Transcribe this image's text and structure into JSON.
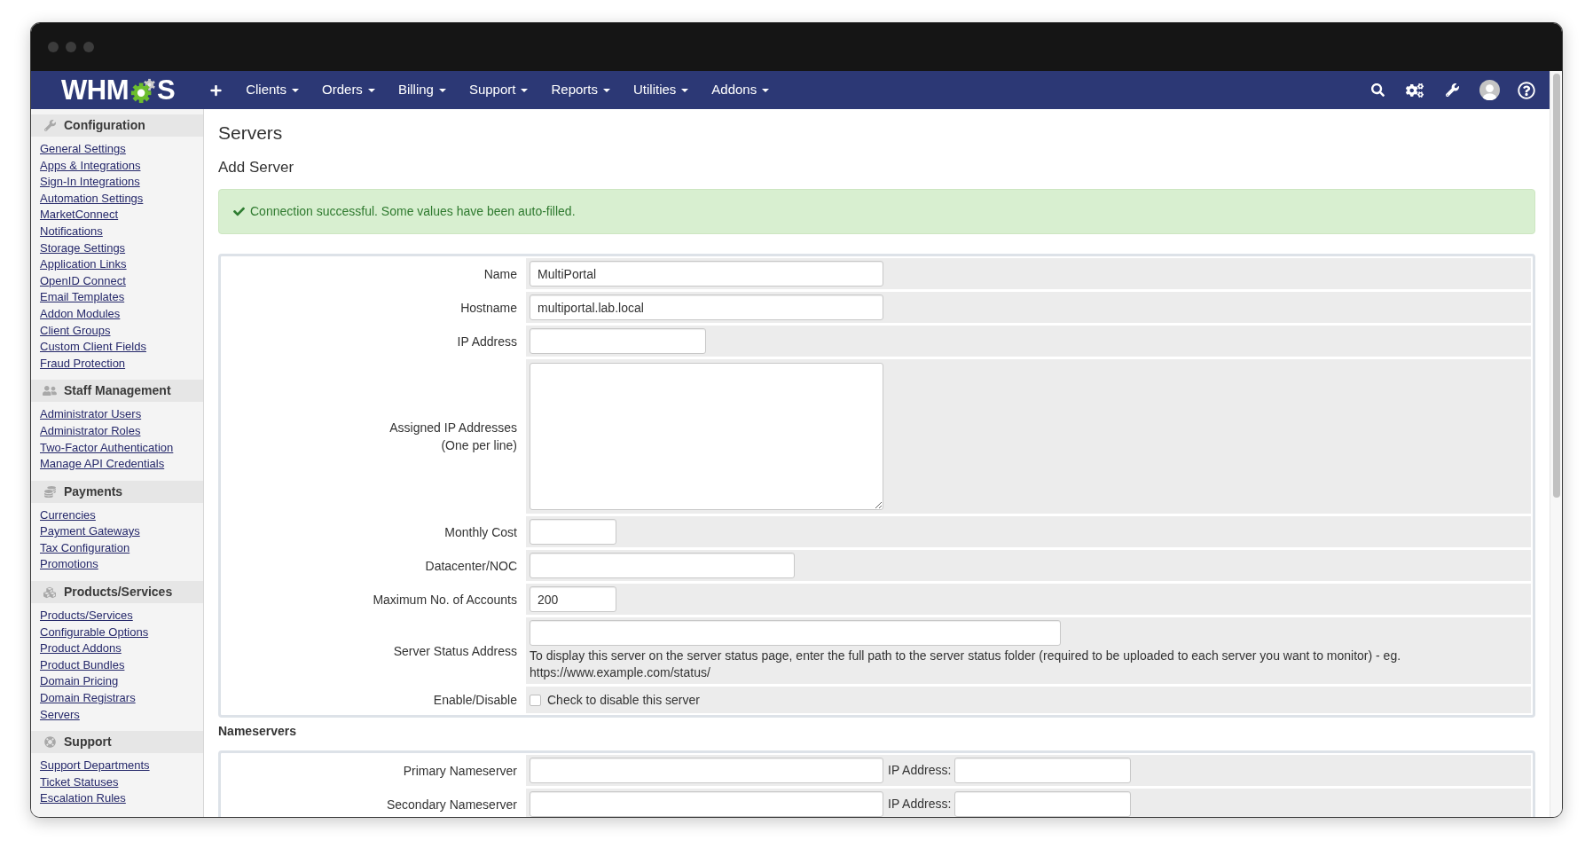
{
  "nav": {
    "logo": {
      "lead": "WHM",
      "tail": "S"
    },
    "menus": [
      "Clients",
      "Orders",
      "Billing",
      "Support",
      "Reports",
      "Utilities",
      "Addons"
    ]
  },
  "sidebar": {
    "sections": [
      {
        "title": "Configuration",
        "links": [
          "General Settings",
          "Apps & Integrations",
          "Sign-In Integrations",
          "Automation Settings",
          "MarketConnect",
          "Notifications",
          "Storage Settings",
          "Application Links",
          "OpenID Connect",
          "Email Templates",
          "Addon Modules",
          "Client Groups",
          "Custom Client Fields",
          "Fraud Protection"
        ]
      },
      {
        "title": "Staff Management",
        "links": [
          "Administrator Users",
          "Administrator Roles",
          "Two-Factor Authentication",
          "Manage API Credentials"
        ]
      },
      {
        "title": "Payments",
        "links": [
          "Currencies",
          "Payment Gateways",
          "Tax Configuration",
          "Promotions"
        ]
      },
      {
        "title": "Products/Services",
        "links": [
          "Products/Services",
          "Configurable Options",
          "Product Addons",
          "Product Bundles",
          "Domain Pricing",
          "Domain Registrars",
          "Servers"
        ]
      },
      {
        "title": "Support",
        "links": [
          "Support Departments",
          "Ticket Statuses",
          "Escalation Rules"
        ]
      }
    ]
  },
  "page": {
    "title": "Servers",
    "subtitle": "Add Server"
  },
  "alert": {
    "message": "Connection successful. Some values have been auto-filled."
  },
  "server_form": {
    "rows": [
      {
        "kind": "input",
        "label": "Name",
        "value": "MultiPortal"
      },
      {
        "kind": "input",
        "label": "Hostname",
        "value": "multiportal.lab.local"
      },
      {
        "kind": "input",
        "label": "IP Address"
      },
      {
        "kind": "textarea",
        "label": "Assigned IP Addresses",
        "label_note": "(One per line)"
      },
      {
        "kind": "input",
        "label": "Monthly Cost"
      },
      {
        "kind": "input",
        "label": "Datacenter/NOC"
      },
      {
        "kind": "input",
        "label": "Maximum No. of Accounts",
        "value": "200"
      },
      {
        "kind": "input_help",
        "label": "Server Status Address",
        "help": "To display this server on the server status page, enter the full path to the server status folder (required to be uploaded to each server you want to monitor) - eg. https://www.example.com/status/"
      },
      {
        "kind": "checkbox",
        "label": "Enable/Disable",
        "text": "Check to disable this server",
        "checked": false
      }
    ]
  },
  "nameservers": {
    "title": "Nameservers",
    "rows": [
      {
        "label": "Primary Nameserver",
        "ip_label": "IP Address:"
      },
      {
        "label": "Secondary Nameserver",
        "ip_label": "IP Address:"
      }
    ]
  }
}
